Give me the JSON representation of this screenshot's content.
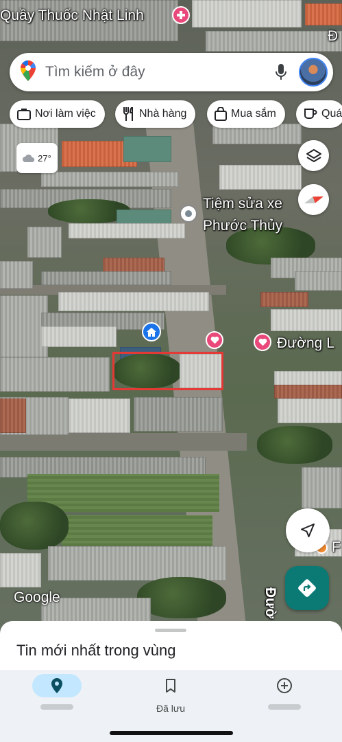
{
  "map": {
    "top_label": "Quầy Thuốc Nhật Linh",
    "top_right_label": "Đ",
    "poi_1_line1": "Tiệm sửa xe",
    "poi_1_line2": "Phước Thủy",
    "poi_2": "Đường L",
    "bottom_right_label": "F",
    "road_label": "Đườ",
    "weather": "27°",
    "google_logo": "Google",
    "selection_color": "#e53935"
  },
  "search": {
    "placeholder": "Tìm kiếm ở đây",
    "icon": "google-maps-pin-icon",
    "mic_icon": "microphone-icon",
    "avatar_icon": "user-avatar"
  },
  "chips": [
    {
      "label": "Nơi làm việc",
      "icon": "briefcase-icon"
    },
    {
      "label": "Nhà hàng",
      "icon": "restaurant-icon"
    },
    {
      "label": "Mua sắm",
      "icon": "shopping-bag-icon"
    },
    {
      "label": "Quá",
      "icon": "coffee-icon"
    }
  ],
  "sheet": {
    "title": "Tin mới nhất trong vùng"
  },
  "nav": {
    "items": [
      {
        "label": "",
        "icon": "explore-pin-icon",
        "active": true
      },
      {
        "label": "Đã lưu",
        "icon": "bookmark-icon",
        "active": false
      },
      {
        "label": "",
        "icon": "add-circle-icon",
        "active": false
      }
    ]
  },
  "colors": {
    "accent": "#0b7a75",
    "nav_active_pill": "#c2e7ff",
    "poi_pink": "#e8497a",
    "home_blue": "#1a73e8"
  }
}
